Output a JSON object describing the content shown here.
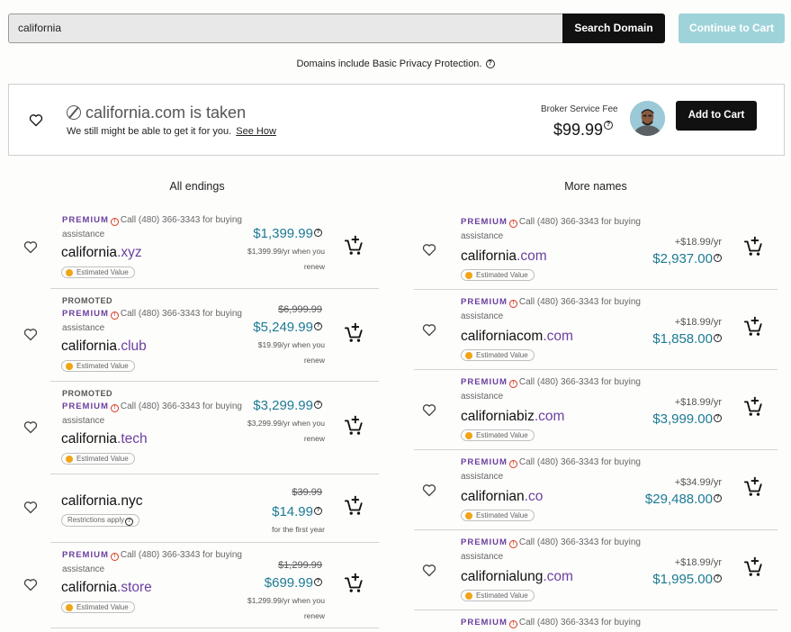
{
  "search": {
    "value": "california",
    "button": "Search Domain",
    "continue": "Continue to Cart"
  },
  "privacy_note": "Domains include Basic Privacy Protection.",
  "taken": {
    "title": "california.com is taken",
    "subtitle": "We still might be able to get it for you.",
    "link": "See How",
    "broker_label": "Broker Service Fee",
    "broker_price": "$99.99",
    "add_button": "Add to Cart"
  },
  "columns": {
    "left": "All endings",
    "right": "More names"
  },
  "labels": {
    "premium": "PREMIUM",
    "promoted": "PROMOTED",
    "call": "Call (480) 366-3343 for buying assistance",
    "estimated": "Estimated Value",
    "restrictions": "Restrictions apply"
  },
  "left": [
    {
      "name": "california",
      "tld": ".xyz",
      "promoted": false,
      "premium": true,
      "strike": "",
      "price": "$1,399.99",
      "renew": "$1,399.99/yr when you renew"
    },
    {
      "name": "california",
      "tld": ".club",
      "promoted": true,
      "premium": true,
      "strike": "$6,999.99",
      "price": "$5,249.99",
      "renew": "$19.99/yr when you renew"
    },
    {
      "name": "california",
      "tld": ".tech",
      "promoted": true,
      "premium": true,
      "strike": "",
      "price": "$3,299.99",
      "renew": "$3,299.99/yr when you renew"
    },
    {
      "name": "california.nyc",
      "tld": "",
      "promoted": false,
      "premium": false,
      "strike": "$39.99",
      "price": "$14.99",
      "renew": "for the first year"
    },
    {
      "name": "california",
      "tld": ".store",
      "promoted": false,
      "premium": true,
      "strike": "$1,299.99",
      "price": "$699.99",
      "renew": "$1,299.99/yr when you renew"
    }
  ],
  "right": [
    {
      "name": "california",
      "tld": ".com",
      "plus": "+$18.99/yr",
      "price": "$2,937.00"
    },
    {
      "name": "californiacom",
      "tld": ".com",
      "plus": "+$18.99/yr",
      "price": "$1,858.00"
    },
    {
      "name": "californiabiz",
      "tld": ".com",
      "plus": "+$18.99/yr",
      "price": "$3,999.00"
    },
    {
      "name": "californian",
      "tld": ".co",
      "plus": "+$34.99/yr",
      "price": "$29,488.00"
    },
    {
      "name": "californialung",
      "tld": ".com",
      "plus": "+$18.99/yr",
      "price": "$1,995.00"
    },
    {
      "name": "",
      "tld": "",
      "plus": "",
      "price": ""
    }
  ],
  "colors": {
    "accent": "#6b3f9e",
    "price": "#1d7a94",
    "continue_disabled": "#9fd3da"
  }
}
